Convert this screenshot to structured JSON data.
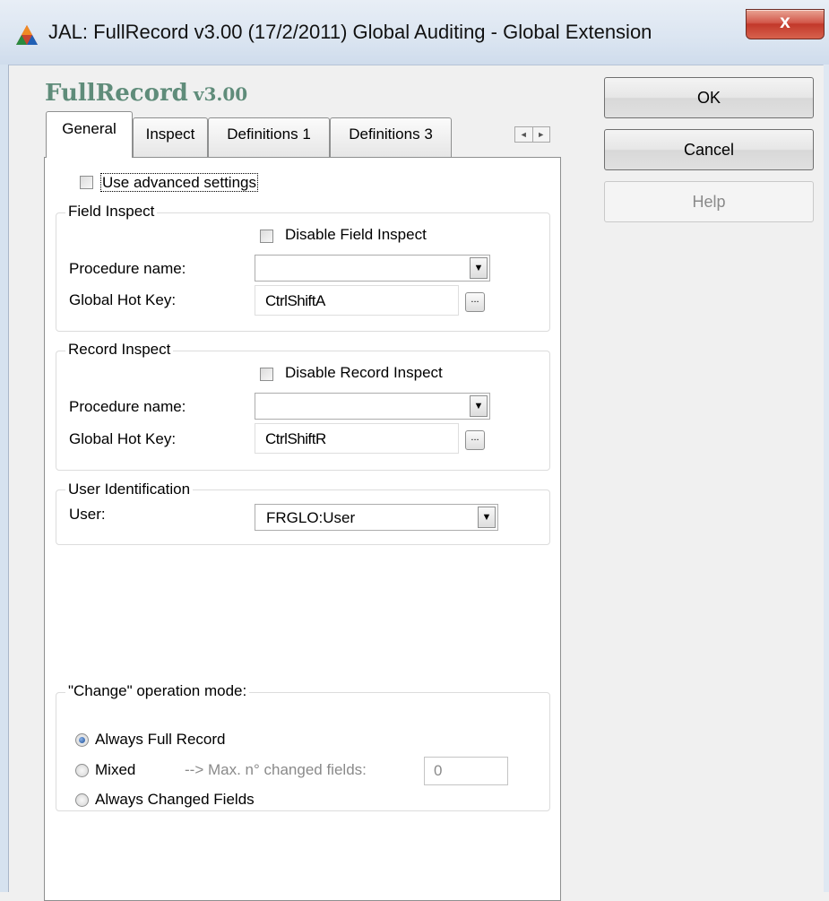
{
  "window": {
    "title": "JAL: FullRecord v3.00 (17/2/2011) Global Auditing - Global Extension",
    "close_label": "x",
    "app_icon": "triangle-logo-icon"
  },
  "heading": {
    "name": "FullRecord",
    "version": "v3.00"
  },
  "tabs": [
    {
      "label": "General",
      "active": true
    },
    {
      "label": "Inspect",
      "active": false
    },
    {
      "label": "Definitions 1",
      "active": false
    },
    {
      "label": "Definitions 3",
      "active": false
    }
  ],
  "tab_scroll": {
    "left": "◄",
    "right": "►"
  },
  "general": {
    "advanced_label": "Use advanced settings",
    "advanced_checked": false,
    "field_inspect": {
      "legend": "Field Inspect",
      "disable_label": "Disable Field Inspect",
      "disable_checked": false,
      "procedure_label": "Procedure name:",
      "procedure_value": "",
      "hotkey_label": "Global Hot Key:",
      "hotkey_value": "CtrlShiftA",
      "ellipsis": "..."
    },
    "record_inspect": {
      "legend": "Record Inspect",
      "disable_label": "Disable Record Inspect",
      "disable_checked": false,
      "procedure_label": "Procedure name:",
      "procedure_value": "",
      "hotkey_label": "Global Hot Key:",
      "hotkey_value": "CtrlShiftR",
      "ellipsis": "..."
    },
    "user_identification": {
      "legend": "User Identification",
      "user_label": "User:",
      "user_value": "FRGLO:User"
    },
    "change_mode": {
      "legend": "\"Change\" operation  mode:",
      "options": [
        {
          "label": "Always Full Record",
          "selected": true
        },
        {
          "label": "Mixed",
          "selected": false
        },
        {
          "label": "Always Changed Fields",
          "selected": false
        }
      ],
      "max_label": "--> Max. n° changed fields:",
      "max_value": "0"
    }
  },
  "buttons": {
    "ok": "OK",
    "cancel": "Cancel",
    "help": "Help"
  },
  "combo_arrow": "▼",
  "colors": {
    "heading": "#5f8c7a",
    "close": "#c2382a",
    "radio_selected": "#1d4e96"
  }
}
